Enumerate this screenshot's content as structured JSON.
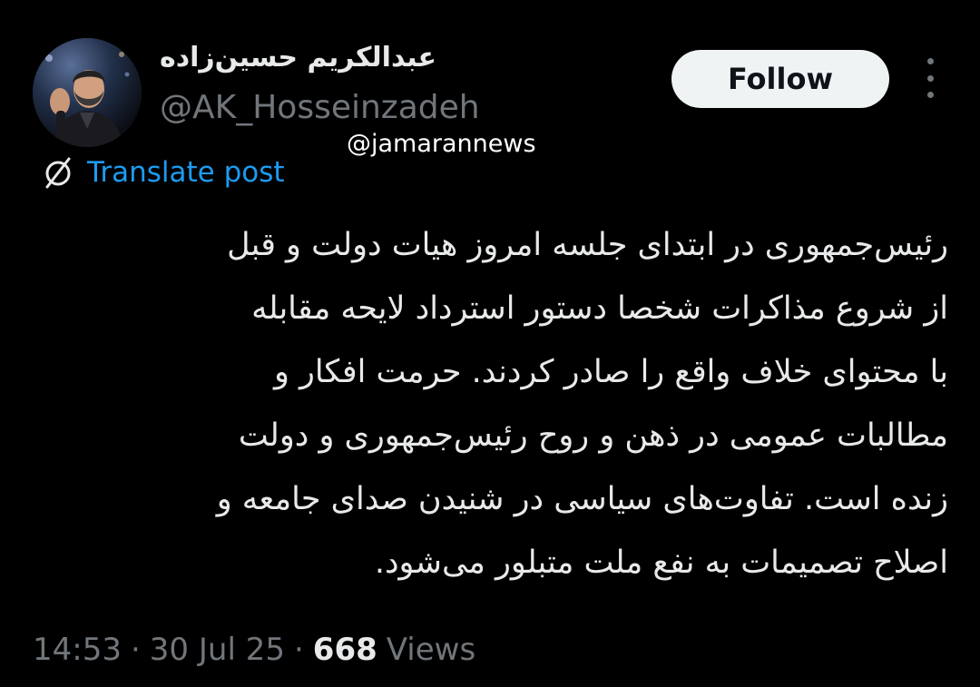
{
  "author": {
    "display_name": "عبدالکریم حسین‌زاده",
    "handle": "@AK_Hosseinzadeh",
    "avatar_icon": "profile-photo"
  },
  "watermark": "@jamarannews",
  "actions": {
    "follow_label": "Follow",
    "more_icon": "more-vertical-icon"
  },
  "translate": {
    "label": "Translate post",
    "icon": "globe-slash-icon"
  },
  "tweet": {
    "lines": [
      "رئیس‌جمهوری در ابتدای جلسه امروز هیات دولت و قبل",
      "از شروع مذاکرات شخصا دستور استرداد لایحه مقابله",
      "با محتوای خلاف واقع را صادر کردند. حرمت افکار و",
      "مطالبات عمومی در ذهن و روح رئیس‌جمهوری و دولت",
      "زنده است. تفاوت‌های سیاسی در شنیدن صدای جامعه و",
      "اصلاح تصمیمات به نفع ملت متبلور می‌شود."
    ]
  },
  "meta": {
    "time": "14:53",
    "separator": "·",
    "date": "30 Jul 25",
    "views_count": "668",
    "views_label": "Views"
  },
  "colors": {
    "background": "#000000",
    "text": "#e7e9ea",
    "muted": "#71767b",
    "link": "#1d9bf0",
    "follow_bg": "#eff3f4"
  }
}
